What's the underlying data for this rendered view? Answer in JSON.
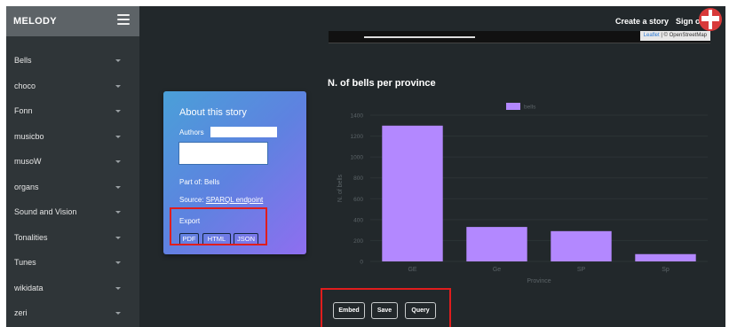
{
  "brand": {
    "name": "MELODY"
  },
  "topbar": {
    "create_story": "Create a story",
    "sign_out": "Sign out"
  },
  "sidebar": {
    "items": [
      {
        "label": "Bells"
      },
      {
        "label": "choco"
      },
      {
        "label": "Fonn"
      },
      {
        "label": "musicbo"
      },
      {
        "label": "musoW"
      },
      {
        "label": "organs"
      },
      {
        "label": "Sound and Vision"
      },
      {
        "label": "Tonalities"
      },
      {
        "label": "Tunes"
      },
      {
        "label": "wikidata"
      },
      {
        "label": "zeri"
      }
    ]
  },
  "map": {
    "attribution_leaflet": "Leaflet",
    "attribution_osm": " | © OpenStreetMap"
  },
  "card": {
    "title": "About this story",
    "authors_label": "Authors",
    "part_of": "Part of: Bells",
    "source_label": "Source: ",
    "source_link": "SPARQL endpoint",
    "export_label": "Export",
    "export_buttons": [
      "PDF",
      "HTML",
      "JSON"
    ]
  },
  "actions": {
    "embed": "Embed",
    "save": "Save",
    "query": "Query"
  },
  "colors": {
    "bar": "#b388ff",
    "highlight": "#e01d1d",
    "background": "#22282b",
    "sidebar": "#2f3538"
  },
  "chart_data": {
    "type": "bar",
    "title": "N. of bells per province",
    "xlabel": "Province",
    "ylabel": "N. of bells",
    "categories": [
      "GE",
      "Ge",
      "SP",
      "Sp"
    ],
    "series": [
      {
        "name": "bells",
        "values": [
          1300,
          330,
          290,
          70
        ]
      }
    ],
    "ylim": [
      0,
      1400
    ],
    "yticks": [
      0,
      200,
      400,
      600,
      800,
      1000,
      1200,
      1400
    ],
    "legend": "top"
  }
}
